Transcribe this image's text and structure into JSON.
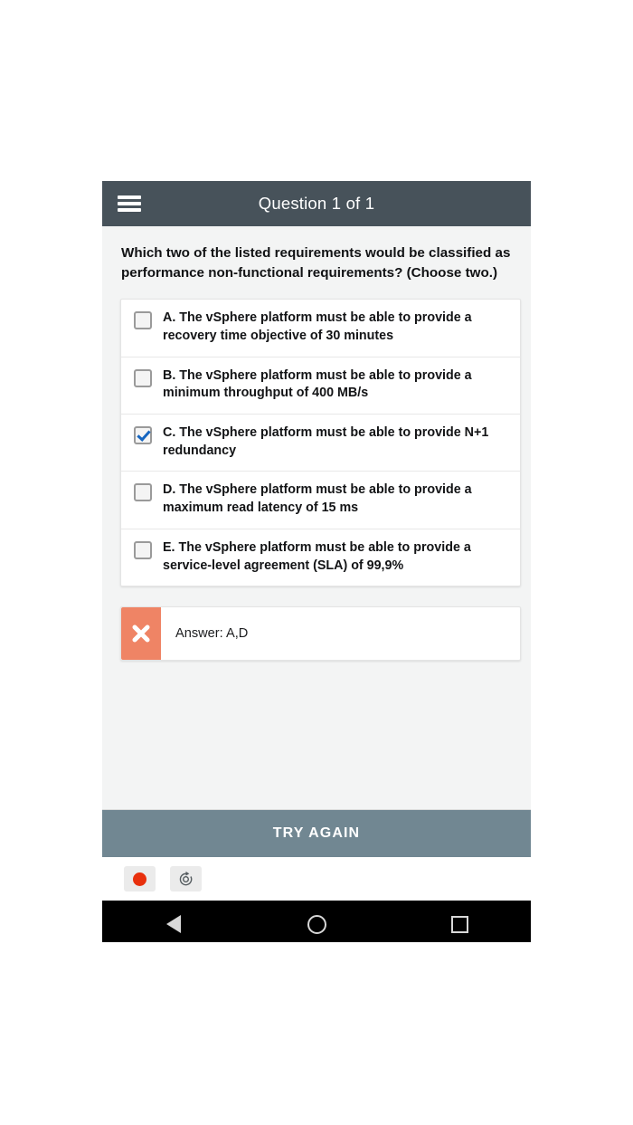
{
  "appbar": {
    "menu_icon": "hamburger-menu-icon",
    "title": "Question 1 of 1"
  },
  "question": {
    "text": "Which two of the listed requirements would be classified as performance non-functional requirements? (Choose two.)"
  },
  "options": [
    {
      "letter": "A",
      "text": "A. The vSphere platform must be able to provide a recovery time objective of 30 minutes",
      "checked": false
    },
    {
      "letter": "B",
      "text": "B. The vSphere platform must be able to provide a minimum throughput of 400 MB/s",
      "checked": false
    },
    {
      "letter": "C",
      "text": "C. The vSphere platform must be able to provide N+1 redundancy",
      "checked": true
    },
    {
      "letter": "D",
      "text": "D. The vSphere platform must be able to provide a maximum read latency of 15 ms",
      "checked": false
    },
    {
      "letter": "E",
      "text": "E. The vSphere platform must be able to provide a service-level agreement (SLA) of 99,9%",
      "checked": false
    }
  ],
  "result": {
    "status_icon": "cross-icon",
    "status": "incorrect",
    "answer_text": "Answer: A,D",
    "badge_color": "#ef8465"
  },
  "try_again": {
    "label": "TRY AGAIN",
    "color": "#718792"
  },
  "toolbar": {
    "record_icon": "record-icon",
    "restart_icon": "restart-icon"
  },
  "navbar": {
    "back_icon": "back-triangle-icon",
    "home_icon": "home-circle-icon",
    "recents_icon": "recents-square-icon"
  },
  "colors": {
    "appbar": "#47525a",
    "page_background": "#f3f4f4",
    "checkbox_checked": "#1565c0"
  }
}
